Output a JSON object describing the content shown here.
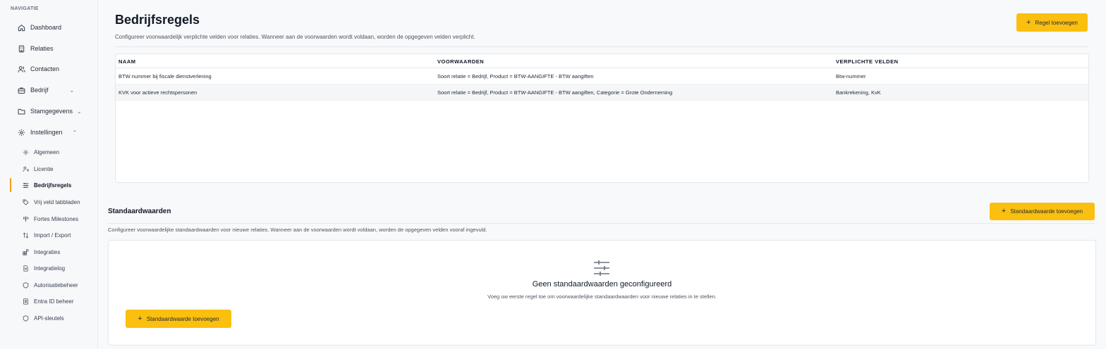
{
  "sidebar": {
    "title": "NAVIGATIE",
    "items": [
      {
        "label": "Dashboard",
        "icon": "home-icon"
      },
      {
        "label": "Relaties",
        "icon": "building-icon"
      },
      {
        "label": "Contacten",
        "icon": "users-icon"
      },
      {
        "label": "Bedrijf",
        "icon": "briefcase-icon",
        "chevron": "⌄"
      },
      {
        "label": "Stamgegevens",
        "icon": "folder-icon",
        "chevron": "⌄"
      },
      {
        "label": "Instellingen",
        "icon": "gear-icon",
        "chevron": "⌃"
      }
    ],
    "sub_items": [
      {
        "label": "Algemeen",
        "icon": "gear-icon"
      },
      {
        "label": "Licentie",
        "icon": "user-key-icon"
      },
      {
        "label": "Bedrijfsregels",
        "icon": "sliders-icon",
        "active": true
      },
      {
        "label": "Vrij veld tabbladen",
        "icon": "tag-icon"
      },
      {
        "label": "Fortes Milestones",
        "icon": "signpost-icon"
      },
      {
        "label": "Import / Export",
        "icon": "arrows-updown-icon"
      },
      {
        "label": "Integraties",
        "icon": "blocks-icon"
      },
      {
        "label": "Integratielog",
        "icon": "file-text-icon"
      },
      {
        "label": "Autorisatiebeheer",
        "icon": "shield-icon"
      },
      {
        "label": "Entra ID beheer",
        "icon": "id-card-icon"
      },
      {
        "label": "API-sleutels",
        "icon": "shield-icon"
      }
    ]
  },
  "header": {
    "title": "Bedrijfsregels",
    "description": "Configureer voorwaardelijk verplichte velden voor relaties. Wanneer aan de voorwaarden wordt voldaan, worden de opgegeven velden verplicht.",
    "add_button": "Regel toevoegen"
  },
  "rules_table": {
    "columns": [
      "NAAM",
      "VOORWAARDEN",
      "VERPLICHTE VELDEN"
    ],
    "rows": [
      {
        "naam": "BTW nummer bij fiscale dienstverlening",
        "voorwaarden": "Soort relatie = Bedrijf, Product = BTW-AANGIFTE - BTW aangiften",
        "velden": "Btw-nummer"
      },
      {
        "naam": "KVK voor actieve rechtspersonen",
        "voorwaarden": "Soort relatie = Bedrijf, Product = BTW-AANGIFTE - BTW aangiften, Categorie = Grote Onderneming",
        "velden": "Bankrekening, KvK"
      }
    ]
  },
  "defaults": {
    "title": "Standaardwaarden",
    "description": "Configureer voorwaardelijke standaardwaarden voor nieuwe relaties. Wanneer aan de voorwaarden wordt voldaan, worden de opgegeven velden vooraf ingevuld.",
    "add_button": "Standaardwaarde toevoegen",
    "empty_title": "Geen standaardwaarden geconfigureerd",
    "empty_description": "Voeg uw eerste regel toe om voorwaardelijke standaardwaarden voor nieuwe relaties in te stellen.",
    "empty_button": "Standaardwaarde toevoegen"
  },
  "colors": {
    "accent": "#fbbf10",
    "active_bar": "#f59e0b"
  }
}
